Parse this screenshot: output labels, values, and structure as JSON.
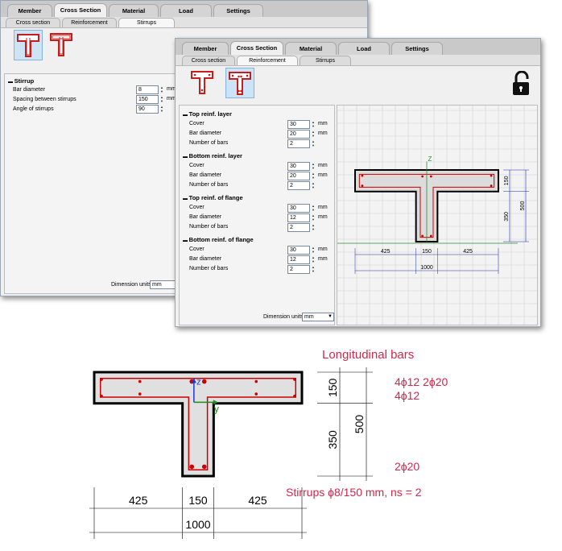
{
  "main_tabs": [
    "Member",
    "Cross Section",
    "Material",
    "Load",
    "Settings"
  ],
  "back_window": {
    "subtabs": [
      "Cross section",
      "Reinforcement",
      "Stirrups"
    ],
    "section_title": "Stirrup",
    "fields": [
      {
        "label": "Bar diameter",
        "value": "8",
        "unit": "mm"
      },
      {
        "label": "Spacing between stirrups",
        "value": "150",
        "unit": "mm"
      },
      {
        "label": "Angle of stirrups",
        "value": "90",
        "unit": ""
      }
    ],
    "dim_units_label": "Dimension units:",
    "dim_units_value": "mm"
  },
  "front_window": {
    "subtabs": [
      "Cross section",
      "Reinforcement",
      "Stirrups"
    ],
    "sections": [
      {
        "title": "Top reinf. layer",
        "fields": [
          {
            "label": "Cover",
            "value": "30",
            "unit": "mm"
          },
          {
            "label": "Bar diameter",
            "value": "20",
            "unit": "mm"
          },
          {
            "label": "Number of bars",
            "value": "2",
            "unit": ""
          }
        ]
      },
      {
        "title": "Bottom reinf. layer",
        "fields": [
          {
            "label": "Cover",
            "value": "30",
            "unit": "mm"
          },
          {
            "label": "Bar diameter",
            "value": "20",
            "unit": "mm"
          },
          {
            "label": "Number of bars",
            "value": "2",
            "unit": ""
          }
        ]
      },
      {
        "title": "Top reinf. of flange",
        "fields": [
          {
            "label": "Cover",
            "value": "30",
            "unit": "mm"
          },
          {
            "label": "Bar diameter",
            "value": "12",
            "unit": "mm"
          },
          {
            "label": "Number of bars",
            "value": "2",
            "unit": ""
          }
        ]
      },
      {
        "title": "Bottom reinf. of flange",
        "fields": [
          {
            "label": "Cover",
            "value": "30",
            "unit": "mm"
          },
          {
            "label": "Bar diameter",
            "value": "12",
            "unit": "mm"
          },
          {
            "label": "Number of bars",
            "value": "2",
            "unit": ""
          }
        ]
      }
    ],
    "dim_units_label": "Dimension units:",
    "dim_units_value": "mm",
    "preview": {
      "axis_z": "Z",
      "dims_bottom": [
        "425",
        "150",
        "425"
      ],
      "dim_total": "1000",
      "dims_right": [
        "150",
        "350"
      ],
      "dim_height": "500"
    }
  },
  "drawing": {
    "title": "Longitudinal bars",
    "bars_top_line1": "4ϕ12  2ϕ20",
    "bars_top_line2": "4ϕ12",
    "bars_bottom": "2ϕ20",
    "stirrups": "Stirrups  ϕ8/150 mm, ns = 2",
    "axis_z": "z",
    "axis_y": "y",
    "dims_bottom": [
      "425",
      "150",
      "425"
    ],
    "dim_total": "1000",
    "dims_left": [
      "150",
      "350"
    ],
    "dim_height": "500"
  },
  "colors": {
    "accent_red": "#d6254a",
    "section_outline": "#000000",
    "rebar": "#cc0000",
    "dim_blue": "#1f2fa8"
  }
}
